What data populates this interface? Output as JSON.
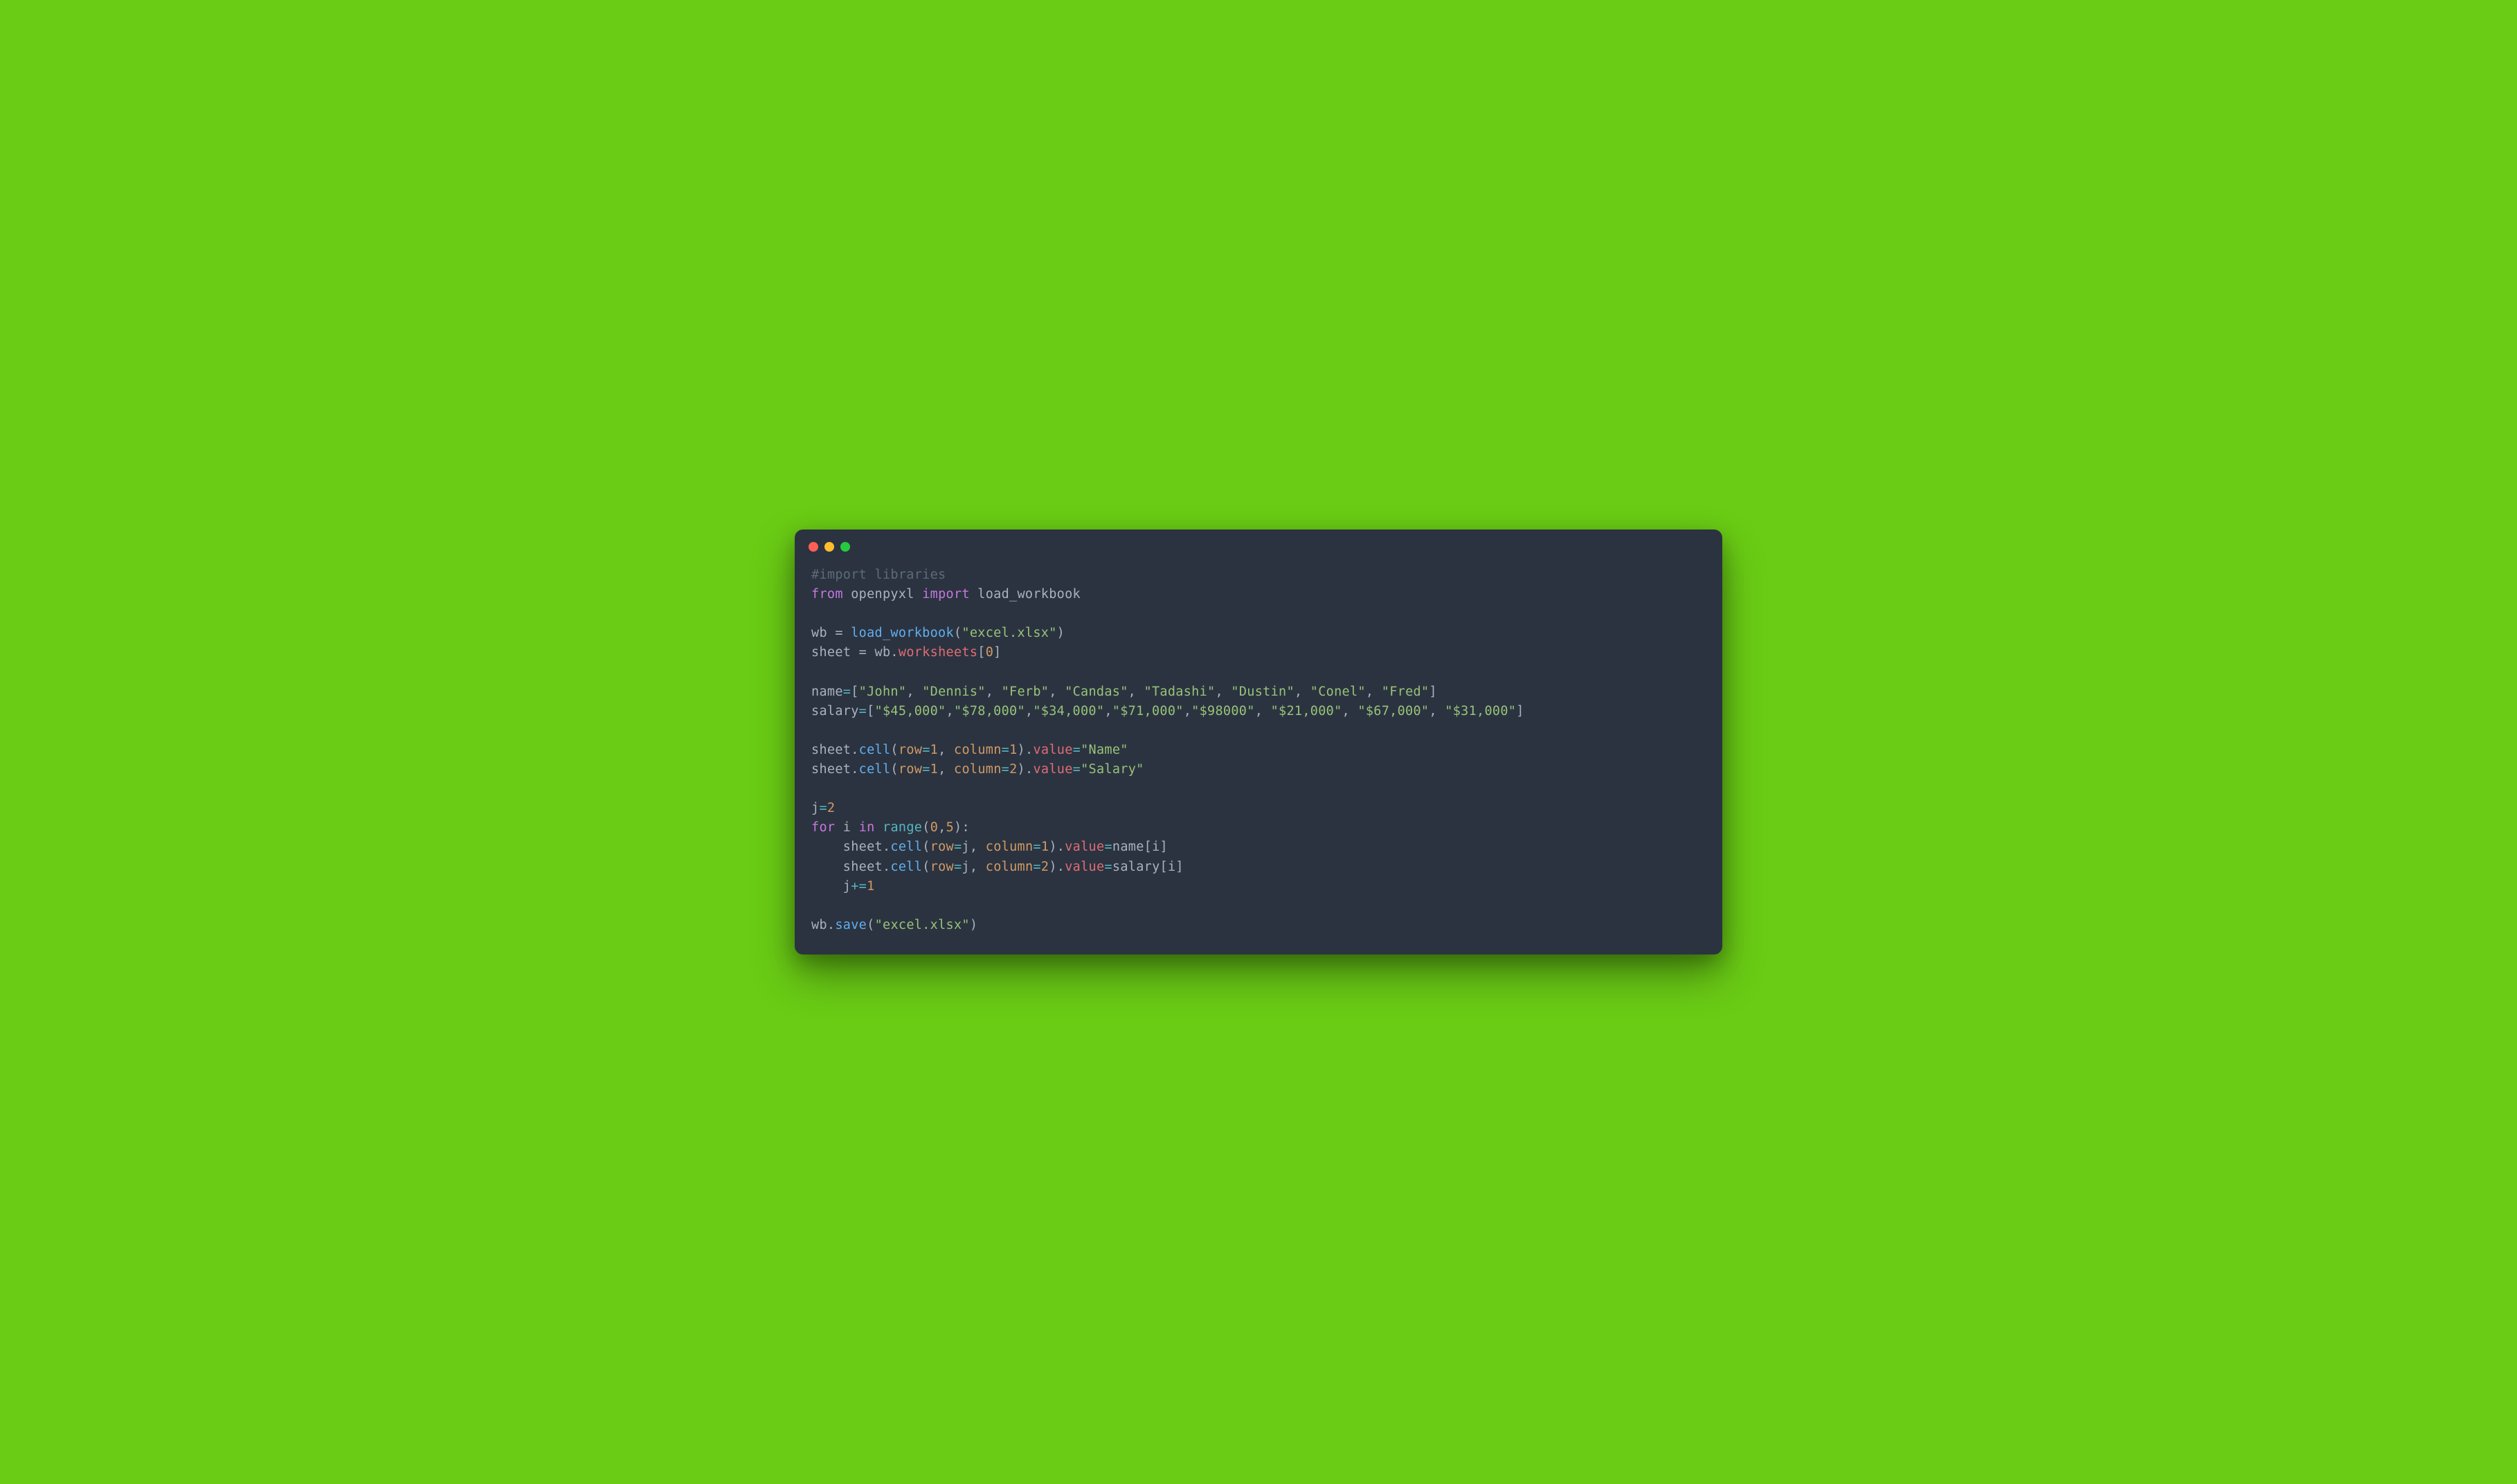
{
  "window": {
    "traffic_lights": [
      "close",
      "minimize",
      "zoom"
    ]
  },
  "code": {
    "line1_comment": "#import libraries",
    "line2_from": "from",
    "line2_module": "openpyxl",
    "line2_import": "import",
    "line2_name": "load_workbook",
    "line4_wb": "wb",
    "line4_eq": " = ",
    "line4_func": "load_workbook",
    "line4_arg": "\"excel.xlsx\"",
    "line5_sheet": "sheet",
    "line5_eq": " = ",
    "line5_wb": "wb",
    "line5_dot": ".",
    "line5_worksheets": "worksheets",
    "line5_idx": "0",
    "line7_name": "name",
    "line7_eq": "=",
    "line7_list": "[\"John\", \"Dennis\", \"Ferb\", \"Candas\", \"Tadashi\", \"Dustin\", \"Conel\", \"Fred\"]",
    "name_items": [
      "\"John\"",
      "\"Dennis\"",
      "\"Ferb\"",
      "\"Candas\"",
      "\"Tadashi\"",
      "\"Dustin\"",
      "\"Conel\"",
      "\"Fred\""
    ],
    "line8_salary": "salary",
    "line8_eq": "=",
    "salary_items": [
      "\"$45,000\"",
      "\"$78,000\"",
      "\"$34,000\"",
      "\"$71,000\"",
      "\"$98000\"",
      "\"$21,000\"",
      "\"$67,000\"",
      "\"$31,000\""
    ],
    "line10_sheet": "sheet",
    "line10_cell": "cell",
    "line10_row": "row",
    "line10_rownum": "1",
    "line10_col": "column",
    "line10_colnum": "1",
    "line10_value": "value",
    "line10_str": "\"Name\"",
    "line11_colnum": "2",
    "line11_str": "\"Salary\"",
    "line13_j": "j",
    "line13_val": "2",
    "line14_for": "for",
    "line14_i": "i",
    "line14_in": "in",
    "line14_range": "range",
    "line14_start": "0",
    "line14_end": "5",
    "line15_rowvar": "j",
    "line15_colnum": "1",
    "line15_src": "name",
    "line15_idx": "i",
    "line16_colnum": "2",
    "line16_src": "salary",
    "line17_j": "j",
    "line17_inc": "1",
    "line19_wb": "wb",
    "line19_save": "save",
    "line19_arg": "\"excel.xlsx\""
  }
}
